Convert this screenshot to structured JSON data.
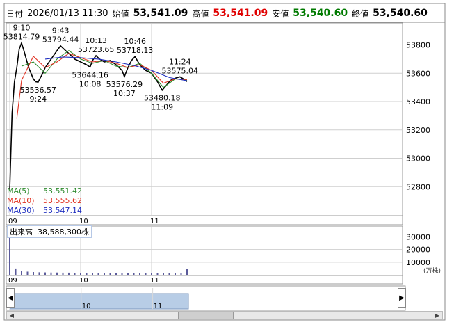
{
  "header": {
    "date_label": "日付",
    "datetime": "2026/01/13 11:30",
    "open_label": "始値",
    "open": "53,541.09",
    "high_label": "高値",
    "high": "53,541.09",
    "low_label": "安値",
    "low": "53,540.60",
    "close_label": "終値",
    "close": "53,540.60"
  },
  "colors": {
    "high": "#e00000",
    "low": "#007a00",
    "candle": "#000000",
    "ma5": "#2e8b2e",
    "ma10": "#e03020",
    "ma30": "#2030c0",
    "volume": "#5a5a9a",
    "grid": "#cfcfcf",
    "navigator_fill": "#b8cde6"
  },
  "ma_legend": [
    {
      "name": "MA(5)",
      "value": "53,551.42",
      "color": "#2e8b2e"
    },
    {
      "name": "MA(10)",
      "value": "53,555.62",
      "color": "#e03020"
    },
    {
      "name": "MA(30)",
      "value": "53,547.14",
      "color": "#2030c0"
    }
  ],
  "volume_label": "出来高",
  "volume_total": "38,588,300株",
  "volume_unit": "(万株)",
  "chart_data": {
    "type": "line",
    "title": "",
    "price": {
      "ylim": [
        52600,
        53950
      ],
      "yticks": [
        52800,
        53000,
        53200,
        53400,
        53600,
        53800
      ],
      "xticks": [
        {
          "label": "09",
          "time": "9:00"
        },
        {
          "label": "10",
          "time": "10:00"
        },
        {
          "label": "11",
          "time": "11:00"
        }
      ],
      "series": [
        {
          "name": "price",
          "x": [
            "9:00",
            "9:02",
            "9:04",
            "9:06",
            "9:08",
            "9:10",
            "9:12",
            "9:14",
            "9:16",
            "9:18",
            "9:20",
            "9:22",
            "9:24",
            "9:26",
            "9:28",
            "9:30",
            "9:35",
            "9:40",
            "9:43",
            "9:46",
            "9:50",
            "9:55",
            "10:00",
            "10:05",
            "10:08",
            "10:10",
            "10:13",
            "10:16",
            "10:20",
            "10:25",
            "10:30",
            "10:35",
            "10:37",
            "10:40",
            "10:43",
            "10:46",
            "10:50",
            "10:55",
            "11:00",
            "11:05",
            "11:09",
            "11:12",
            "11:16",
            "11:20",
            "11:24",
            "11:27",
            "11:30"
          ],
          "values": [
            52780,
            53320,
            53540,
            53640,
            53770,
            53814,
            53760,
            53700,
            53640,
            53600,
            53560,
            53540,
            53537,
            53570,
            53600,
            53640,
            53700,
            53760,
            53794,
            53770,
            53740,
            53700,
            53680,
            53660,
            53644,
            53690,
            53724,
            53700,
            53680,
            53690,
            53660,
            53620,
            53576,
            53640,
            53690,
            53718,
            53660,
            53620,
            53600,
            53540,
            53480,
            53510,
            53550,
            53565,
            53575,
            53560,
            53541
          ]
        },
        {
          "name": "MA(5)",
          "x": [
            "9:10",
            "9:20",
            "9:30",
            "9:40",
            "9:50",
            "10:00",
            "10:10",
            "10:20",
            "10:30",
            "10:40",
            "10:50",
            "11:00",
            "11:10",
            "11:20",
            "11:30"
          ],
          "values": [
            53650,
            53680,
            53600,
            53700,
            53760,
            53700,
            53670,
            53690,
            53650,
            53640,
            53670,
            53600,
            53500,
            53560,
            53551
          ]
        },
        {
          "name": "MA(10)",
          "x": [
            "9:06",
            "9:10",
            "9:20",
            "9:30",
            "9:40",
            "9:50",
            "10:00",
            "10:10",
            "10:20",
            "10:30",
            "10:40",
            "10:50",
            "11:00",
            "11:10",
            "11:20",
            "11:30"
          ],
          "values": [
            53280,
            53550,
            53720,
            53640,
            53680,
            53740,
            53710,
            53680,
            53690,
            53670,
            53640,
            53660,
            53620,
            53530,
            53560,
            53556
          ]
        },
        {
          "name": "MA(30)",
          "x": [
            "9:30",
            "9:45",
            "10:00",
            "10:15",
            "10:30",
            "10:45",
            "11:00",
            "11:15",
            "11:30"
          ],
          "values": [
            53700,
            53715,
            53710,
            53700,
            53680,
            53655,
            53620,
            53570,
            53547
          ]
        }
      ],
      "annotations": [
        {
          "time": "9:10",
          "value": 53814.79,
          "text": "53814.79",
          "time_label": "9:10",
          "side": "above"
        },
        {
          "time": "9:43",
          "value": 53794.44,
          "text": "53794.44",
          "time_label": "9:43",
          "side": "above"
        },
        {
          "time": "10:13",
          "value": 53723.65,
          "text": "53723.65",
          "time_label": "10:13",
          "side": "above"
        },
        {
          "time": "10:46",
          "value": 53718.13,
          "text": "53718.13",
          "time_label": "10:46",
          "side": "above"
        },
        {
          "time": "11:24",
          "value": 53575.04,
          "text": "53575.04",
          "time_label": "11:24",
          "side": "above"
        },
        {
          "time": "9:24",
          "value": 53536.57,
          "text": "53536.57",
          "time_label": "9:24",
          "side": "below"
        },
        {
          "time": "10:08",
          "value": 53644.16,
          "text": "53644.16",
          "time_label": "10:08",
          "side": "below"
        },
        {
          "time": "10:37",
          "value": 53576.29,
          "text": "53576.29",
          "time_label": "10:37",
          "side": "below"
        },
        {
          "time": "11:09",
          "value": 53480.18,
          "text": "53480.18",
          "time_label": "11:09",
          "side": "below"
        }
      ]
    },
    "volume": {
      "unit": "万株",
      "ylim": [
        0,
        38000
      ],
      "yticks": [
        10000,
        20000,
        30000
      ],
      "x": [
        "9:00",
        "9:05",
        "9:10",
        "9:15",
        "9:20",
        "9:25",
        "9:30",
        "9:35",
        "9:40",
        "9:45",
        "9:50",
        "9:55",
        "10:00",
        "10:05",
        "10:10",
        "10:15",
        "10:20",
        "10:25",
        "10:30",
        "10:35",
        "10:40",
        "10:45",
        "10:50",
        "10:55",
        "11:00",
        "11:05",
        "11:10",
        "11:15",
        "11:20",
        "11:25",
        "11:30"
      ],
      "values": [
        36000,
        5000,
        3000,
        2500,
        2200,
        2000,
        1900,
        1800,
        1800,
        1700,
        1700,
        1600,
        1600,
        1500,
        1500,
        1500,
        1400,
        1400,
        1400,
        1400,
        1300,
        1300,
        1300,
        1300,
        1300,
        1300,
        1200,
        1200,
        1200,
        1200,
        4500
      ]
    },
    "navigator": {
      "xticks": [
        "9",
        "10",
        "11"
      ]
    },
    "grid": true
  }
}
